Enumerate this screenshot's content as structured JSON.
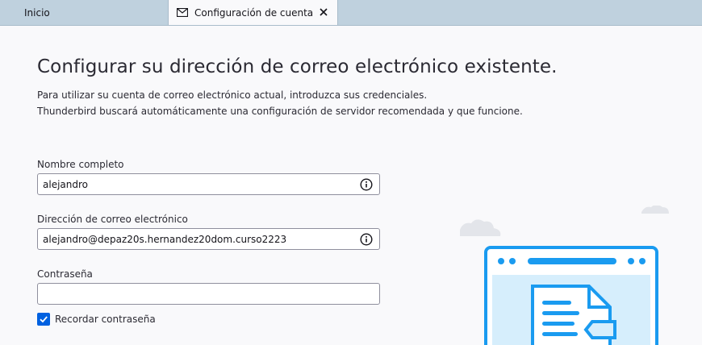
{
  "tabs": {
    "home_label": "Inicio",
    "active_label": "Configuración de cuenta"
  },
  "heading": {
    "title": "Configurar su dirección de correo electrónico existente.",
    "line1": "Para utilizar su cuenta de correo electrónico actual, introduzca sus credenciales.",
    "line2": "Thunderbird buscará automáticamente una configuración de servidor recomendada y que funcione."
  },
  "form": {
    "name_label": "Nombre completo",
    "name_value": "alejandro",
    "email_label": "Dirección de correo electrónico",
    "email_value": "alejandro@depaz20s.hernandez20dom.curso2223",
    "password_label": "Contraseña",
    "password_value": "",
    "remember_label": "Recordar contraseña",
    "remember_checked": true
  },
  "colors": {
    "accent": "#0061e0",
    "illustration_blue": "#1a9bf0",
    "illustration_light": "#d6eefc"
  }
}
